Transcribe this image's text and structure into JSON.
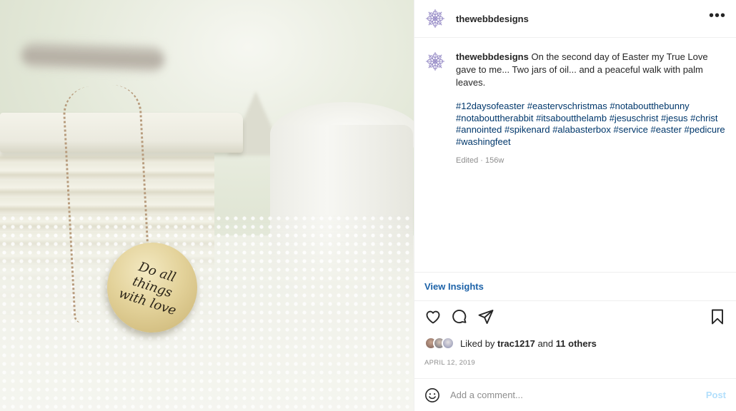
{
  "image": {
    "pendant_text": "Do all\nthings\nwith love"
  },
  "header": {
    "username": "thewebbdesigns",
    "more_label": "•••"
  },
  "caption": {
    "username": "thewebbdesigns",
    "text": "On the second day of Easter my True Love gave to me... Two jars of oil... and a peaceful walk with palm leaves.",
    "hashtags": [
      "#12daysofeaster",
      "#eastervschristmas",
      "#notaboutthebunny",
      "#notabouttherabbit",
      "#itsaboutthelamb",
      "#jesuschrist",
      "#jesus",
      "#christ",
      "#annointed",
      "#spikenard",
      "#alabasterbox",
      "#service",
      "#easter",
      "#pedicure",
      "#washingfeet"
    ],
    "edited": "Edited · 156w"
  },
  "insights": {
    "label": "View Insights"
  },
  "actions": {
    "icons": [
      "heart-icon",
      "comment-icon",
      "share-icon",
      "bookmark-icon"
    ]
  },
  "likes": {
    "prefix": "Liked by",
    "user": "trac1217",
    "and": "and",
    "others": "11 others"
  },
  "date": "APRIL 12, 2019",
  "comment": {
    "placeholder": "Add a comment...",
    "post_label": "Post"
  },
  "colors": {
    "link": "#00376b",
    "insights": "#1c62a8",
    "post_disabled": "#b2dffc",
    "muted": "#8e8e8e"
  }
}
